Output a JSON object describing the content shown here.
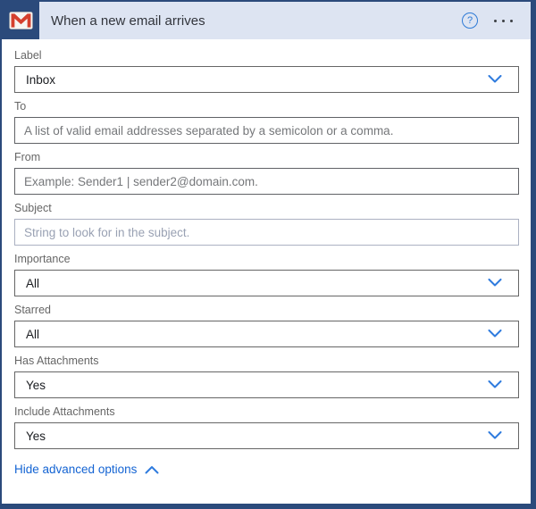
{
  "header": {
    "title": "When a new email arrives",
    "icon": "gmail-icon",
    "help_tooltip": "?",
    "menu": "ellipsis-menu"
  },
  "colors": {
    "card_border": "#2b4a7b",
    "header_bg": "#dde4f2",
    "icon_red": "#d5402e",
    "chevron_blue": "#2f7bde",
    "link_blue": "#1464d3",
    "label_gray": "#666666"
  },
  "fields": [
    {
      "type": "dropdown",
      "label": "Label",
      "value": "Inbox"
    },
    {
      "type": "text",
      "label": "To",
      "value": "",
      "placeholder": "A list of valid email addresses separated by a semicolon or a comma."
    },
    {
      "type": "text",
      "label": "From",
      "value": "",
      "placeholder": "Example: Sender1 | sender2@domain.com."
    },
    {
      "type": "text",
      "style": "light",
      "label": "Subject",
      "value": "",
      "placeholder": "String to look for in the subject."
    },
    {
      "type": "dropdown",
      "label": "Importance",
      "value": "All"
    },
    {
      "type": "dropdown",
      "label": "Starred",
      "value": "All"
    },
    {
      "type": "dropdown",
      "label": "Has Attachments",
      "value": "Yes"
    },
    {
      "type": "dropdown",
      "label": "Include Attachments",
      "value": "Yes"
    }
  ],
  "footer": {
    "link_label": "Hide advanced options"
  }
}
